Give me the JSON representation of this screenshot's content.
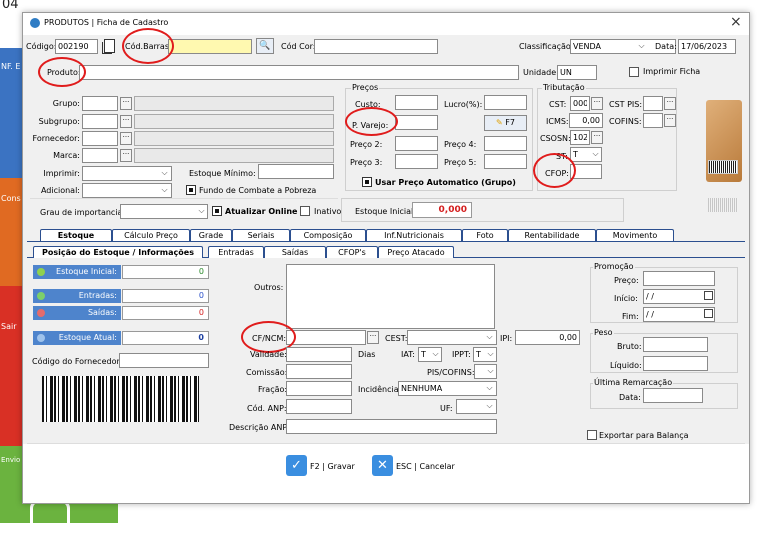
{
  "background": {
    "corner_text": "04",
    "left_labels": [
      "NF. E",
      "Cons",
      "Sair",
      "Envio"
    ],
    "colors": {
      "orange": "#e06a22",
      "red": "#d93025",
      "green": "#6bb33f",
      "blue": "#3b73c2"
    }
  },
  "window": {
    "title": "PRODUTOS | Ficha de Cadastro",
    "close_glyph": "×"
  },
  "top": {
    "codigo_label": "Código:",
    "codigo_value": "002190",
    "cod_barras_label": "Cód.Barras:",
    "cod_barras_value": "",
    "cod_cor_label": "Cód Cor:",
    "classificacao_label": "Classificação:",
    "classificacao_value": "VENDA",
    "data_label": "Data:",
    "data_value": "17/06/2023",
    "produto_label": "Produto:",
    "unidade_label": "Unidade:",
    "unidade_value": "UN",
    "imprimir_ficha_label": "Imprimir Ficha"
  },
  "left_fields": {
    "grupo": "Grupo:",
    "subgrupo": "Subgrupo:",
    "fornecedor": "Fornecedor:",
    "marca": "Marca:",
    "imprimir": "Imprimir:",
    "estoque_minimo": "Estoque Mínimo:",
    "adicional": "Adicional:",
    "fundo_combate": "Fundo de Combate a Pobreza",
    "grau_importancia": "Grau de importancia",
    "atualizar_online": "Atualizar Online",
    "inativo": "Inativo",
    "estoque_inicial_label": "Estoque Inicial:",
    "estoque_inicial_value": "0,000",
    "dots": "···"
  },
  "precos": {
    "title": "Preços",
    "custo": "Custo:",
    "lucro": "Lucro(%):",
    "p_varejo": "P. Varejo:",
    "f7": "F7",
    "preco2": "Preço 2:",
    "preco4": "Preço 4:",
    "preco3": "Preço 3:",
    "preco5": "Preço 5:",
    "usar_auto": "Usar Preço Automatico (Grupo)"
  },
  "tributacao": {
    "title": "Tributação",
    "cst_label": "CST:",
    "cst_value": "000",
    "cst_pis_label": "CST PIS:",
    "icms_label": "ICMS:",
    "icms_value": "0,00",
    "cofins_label": "COFINS:",
    "csosn_label": "CSOSN:",
    "csosn_value": "102",
    "st_label": "ST:",
    "st_value": "T",
    "cfop_label": "CFOP:"
  },
  "tabs_main": [
    "Estoque",
    "Cálculo Preço",
    "Grade",
    "Seriais",
    "Composição",
    "Inf.Nutricionais",
    "Foto",
    "Rentabilidade",
    "Movimento"
  ],
  "tabs_sub": [
    "Posição do Estoque / Informações",
    "Entradas",
    "Saídas",
    "CFOP's",
    "Preço Atacado"
  ],
  "stock": {
    "inicial_label": "Estoque Inicial:",
    "inicial_value": "0",
    "entradas_label": "Entradas:",
    "entradas_value": "0",
    "saidas_label": "Saídas:",
    "saidas_value": "0",
    "atual_label": "Estoque Atual:",
    "atual_value": "0",
    "cod_fornecedor_label": "Código do Fornecedor:"
  },
  "info": {
    "outros": "Outros:",
    "cf_ncm": "CF/NCM:",
    "cest": "CEST:",
    "ipi_label": "IPI:",
    "ipi_value": "0,00",
    "validade": "Validade:",
    "dias": "Dias",
    "iat_label": "IAT:",
    "iat_value": "T",
    "ippt_label": "IPPT:",
    "ippt_value": "T",
    "comissao": "Comissão:",
    "pis_cofins": "PIS/COFINS:",
    "fracao": "Fração:",
    "incidencia_label": "Incidência:",
    "incidencia_value": "NENHUMA",
    "cod_anp": "Cód. ANP:",
    "uf": "UF:",
    "descricao_anp": "Descrição ANP:"
  },
  "promocao": {
    "title": "Promoção",
    "preco": "Preço:",
    "inicio": "Início:",
    "inicio_value": "/ /",
    "fim": "Fim:",
    "fim_value": "/ /"
  },
  "peso": {
    "title": "Peso",
    "bruto": "Bruto:",
    "liquido": "Líquido:"
  },
  "ultima_remarcacao": {
    "title": "Última Remarcação",
    "data": "Data:"
  },
  "exportar_balanca": "Exportar para Balança",
  "buttons": {
    "gravar": "F2 | Gravar",
    "cancelar": "ESC | Cancelar"
  }
}
